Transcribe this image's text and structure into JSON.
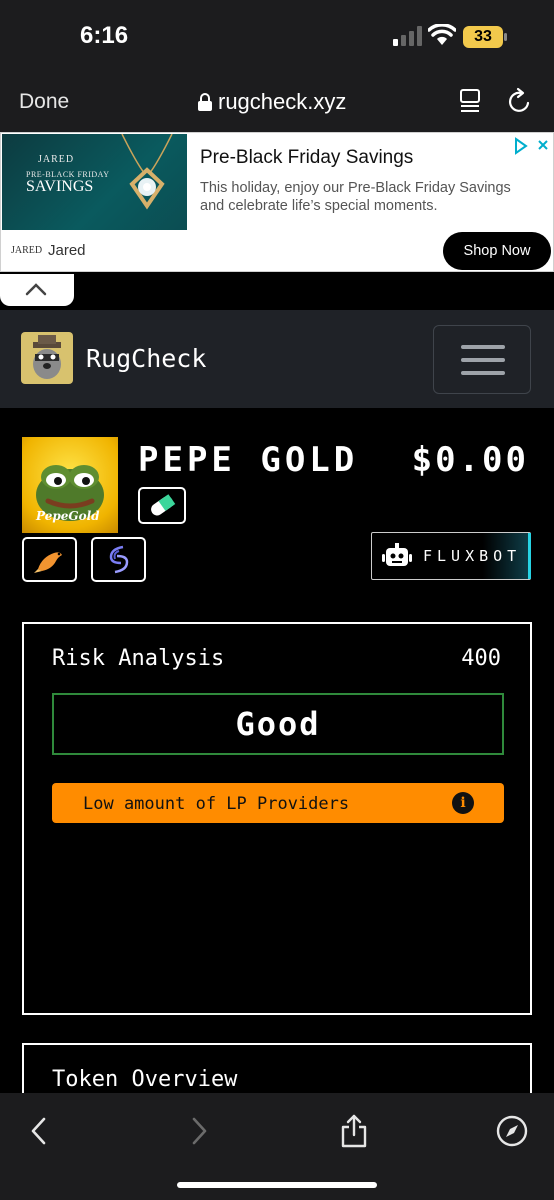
{
  "status_bar": {
    "time": "6:16",
    "battery": "33"
  },
  "browser": {
    "done_label": "Done",
    "url": "rugcheck.xyz"
  },
  "ad": {
    "image_brand": "JARED",
    "image_line": "PRE-BLACK FRIDAY",
    "image_savings": "SAVINGS",
    "title": "Pre-Black Friday Savings",
    "text": "This holiday, enjoy our Pre-Black Friday Savings and celebrate life’s special moments.",
    "logo": "JARED",
    "advertiser": "Jared",
    "cta": "Shop Now"
  },
  "app": {
    "name": "RugCheck"
  },
  "token": {
    "name": "PEPE GOLD",
    "price": "$0.00",
    "image_caption": "PepeGold",
    "fluxbot_label": "FLUXBOT"
  },
  "risk": {
    "title": "Risk Analysis",
    "score": "400",
    "result": "Good",
    "warning": "Low amount of LP Providers"
  },
  "overview": {
    "title": "Token Overview"
  },
  "colors": {
    "warning": "#ff8c00",
    "good_border": "#2f8a3b",
    "fluxbot_accent": "#27d3e4"
  }
}
